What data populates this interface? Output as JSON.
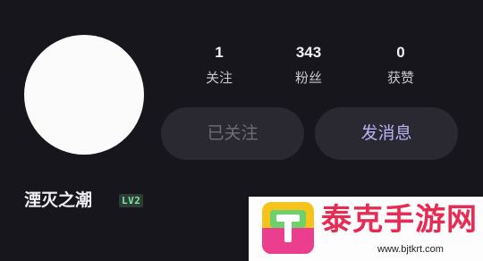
{
  "profile": {
    "name": "湮灭之潮",
    "level": "LV2"
  },
  "stats": [
    {
      "value": "1",
      "label": "关注"
    },
    {
      "value": "343",
      "label": "粉丝"
    },
    {
      "value": "0",
      "label": "获赞"
    }
  ],
  "actions": {
    "followed_label": "已关注",
    "message_label": "发消息"
  },
  "watermark": {
    "title": "泰克手游网",
    "url": "www.bjtkrt.com"
  },
  "colors": {
    "background": "#18161d",
    "button_bg": "#2a2830",
    "message_accent": "#b6b4f5",
    "level_badge_text": "#7fe3a8",
    "watermark_red": "#e72b52"
  }
}
